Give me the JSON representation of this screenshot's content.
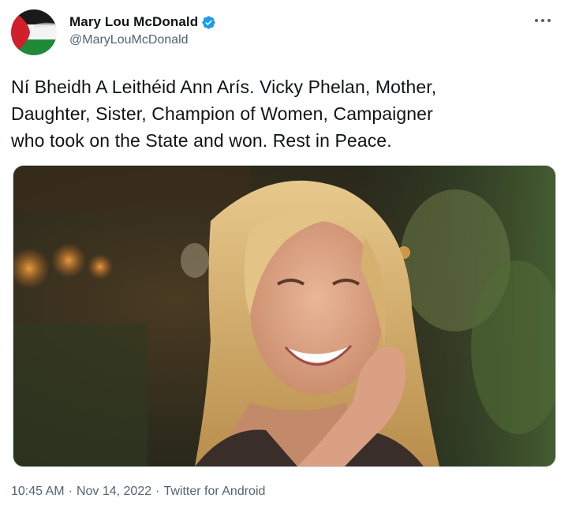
{
  "author": {
    "display_name": "Mary Lou McDonald",
    "handle": "@MaryLouMcDonald",
    "verified": true,
    "avatar_icon": "palestine-flag-avatar",
    "verified_color": "#1d9bf0"
  },
  "more_icon": "more-options-icon",
  "tweet": {
    "text": "Ní Bheidh A Leithéid Ann Arís. Vicky Phelan, Mother,\nDaughter, Sister, Champion of Women, Campaigner\nwho took on the State and won. Rest in Peace."
  },
  "media": {
    "icon": "photo-smiling-woman"
  },
  "meta": {
    "time": "10:45 AM",
    "sep1": "·",
    "date": "Nov 14, 2022",
    "sep2": "·",
    "source": "Twitter for Android"
  },
  "colors": {
    "text": "#0f1419",
    "secondary": "#536471"
  }
}
